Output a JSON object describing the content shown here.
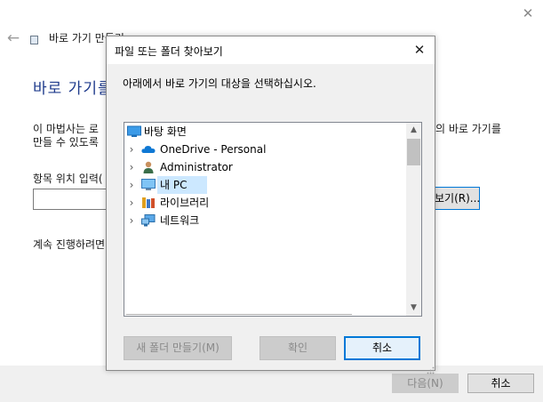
{
  "wizard": {
    "title": "바로 가기 만들기",
    "heading": "바로 가기를",
    "description_line1_left": "이 마법사는 로",
    "description_line2_left": "만들 수 있도록",
    "description_line1_right": "의 바로 가기를",
    "location_label": "항목 위치 입력(",
    "location_value": "",
    "browse_label": "보기(R)...",
    "continue_text": "계속 진행하려면",
    "next_label": "다음(N)",
    "cancel_label": "취소"
  },
  "dialog": {
    "title": "파일 또는 폴더 찾아보기",
    "instruction": "아래에서 바로 가기의 대상을 선택하십시오.",
    "tree": [
      {
        "label": "바탕 화면",
        "icon": "desktop-icon",
        "expandable": false,
        "selected": false
      },
      {
        "label": "OneDrive - Personal",
        "icon": "cloud-icon",
        "expandable": true,
        "selected": false
      },
      {
        "label": "Administrator",
        "icon": "user-icon",
        "expandable": true,
        "selected": false
      },
      {
        "label": "내 PC",
        "icon": "computer-icon",
        "expandable": true,
        "selected": true
      },
      {
        "label": "라이브러리",
        "icon": "library-icon",
        "expandable": true,
        "selected": false
      },
      {
        "label": "네트워크",
        "icon": "network-icon",
        "expandable": true,
        "selected": false
      }
    ],
    "new_folder_label": "새 폴더 만들기(M)",
    "ok_label": "확인",
    "cancel_label": "취소"
  },
  "colors": {
    "accent": "#0078d7",
    "heading_blue": "#1f3b8c",
    "selection": "#cce8ff",
    "onedrive_blue": "#0f78d4"
  }
}
